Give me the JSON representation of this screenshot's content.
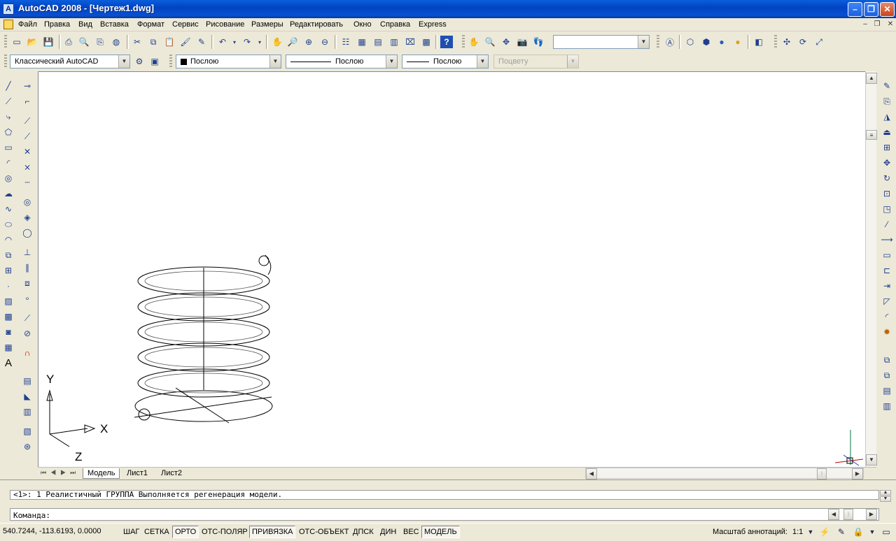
{
  "window": {
    "title": "AutoCAD 2008 - [Чертеж1.dwg]",
    "icon": "autocad-logo-icon",
    "controls": [
      "minimize-icon",
      "restore-icon",
      "close-icon"
    ]
  },
  "menu": {
    "items": [
      "Файл",
      "Правка",
      "Вид",
      "Вставка",
      "Формат",
      "Сервис",
      "Рисование",
      "Размеры",
      "Редактировать",
      "Окно",
      "Справка",
      "Express"
    ],
    "mdi_controls": [
      "document-minimize-icon",
      "document-restore-icon",
      "document-close-icon"
    ]
  },
  "toolbar_properties": {
    "workspace": "Классический AutoCAD",
    "color": "Послою",
    "linetype": "Послою",
    "lineweight": "Послою",
    "plotstyle": "Поцвету",
    "view_combo": ""
  },
  "layout_tabs": [
    "Модель",
    "Лист1",
    "Лист2"
  ],
  "active_tab": "Модель",
  "command": {
    "history": "<1>: 1 Реалистичный ГРУППА Выполняется регенерация модели.",
    "prompt": "Команда:",
    "input": ""
  },
  "status": {
    "coordinates": "540.7244, -113.6193, 0.0000",
    "toggles": [
      {
        "label": "ШАГ",
        "on": false
      },
      {
        "label": "СЕТКА",
        "on": false
      },
      {
        "label": "ОРТО",
        "on": true
      },
      {
        "label": "ОТС-ПОЛЯР",
        "on": false
      },
      {
        "label": "ПРИВЯЗКА",
        "on": true
      },
      {
        "label": "ОТС-ОБЪЕКТ",
        "on": false
      },
      {
        "label": "ДПСК",
        "on": false
      },
      {
        "label": "ДИН",
        "on": false
      },
      {
        "label": "ВЕС",
        "on": false
      },
      {
        "label": "МОДЕЛЬ",
        "on": true
      }
    ],
    "annotation_scale_label": "Масштаб аннотаций:",
    "annotation_scale": "1:1"
  },
  "ucs": {
    "x": "X",
    "y": "Y",
    "z": "Z"
  }
}
